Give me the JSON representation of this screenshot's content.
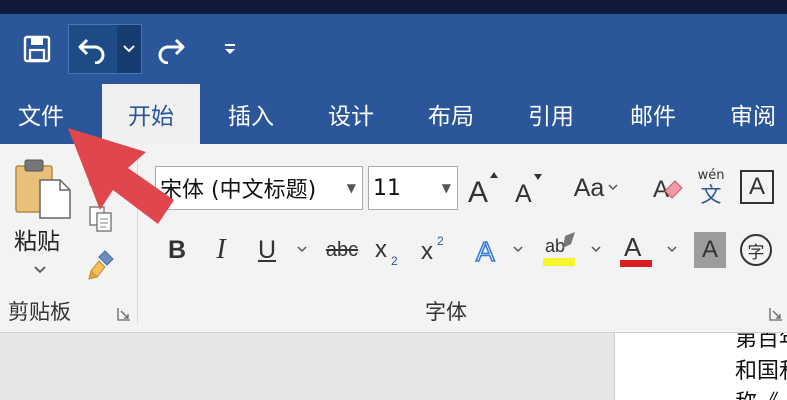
{
  "tabs": [
    {
      "label": "文件",
      "active": false
    },
    {
      "label": "开始",
      "active": true
    },
    {
      "label": "插入",
      "active": false
    },
    {
      "label": "设计",
      "active": false
    },
    {
      "label": "布局",
      "active": false
    },
    {
      "label": "引用",
      "active": false
    },
    {
      "label": "邮件",
      "active": false
    },
    {
      "label": "审阅",
      "active": false
    }
  ],
  "clipboard": {
    "paste_label": "粘贴",
    "group_label": "剪贴板"
  },
  "font": {
    "font_name": "宋体 (中文标题)",
    "font_size": "11",
    "group_label": "字体",
    "case_label": "Aa",
    "phonetic_top": "wén",
    "phonetic_bottom": "文",
    "enclose_char": "字"
  },
  "document": {
    "lines": [
      "第百年",
      "和国和",
      "称《"
    ]
  },
  "colors": {
    "accent": "#2b579a",
    "annotation_arrow": "#e0474c",
    "highlight": "#f5f531",
    "font_color": "#d81e1e"
  }
}
